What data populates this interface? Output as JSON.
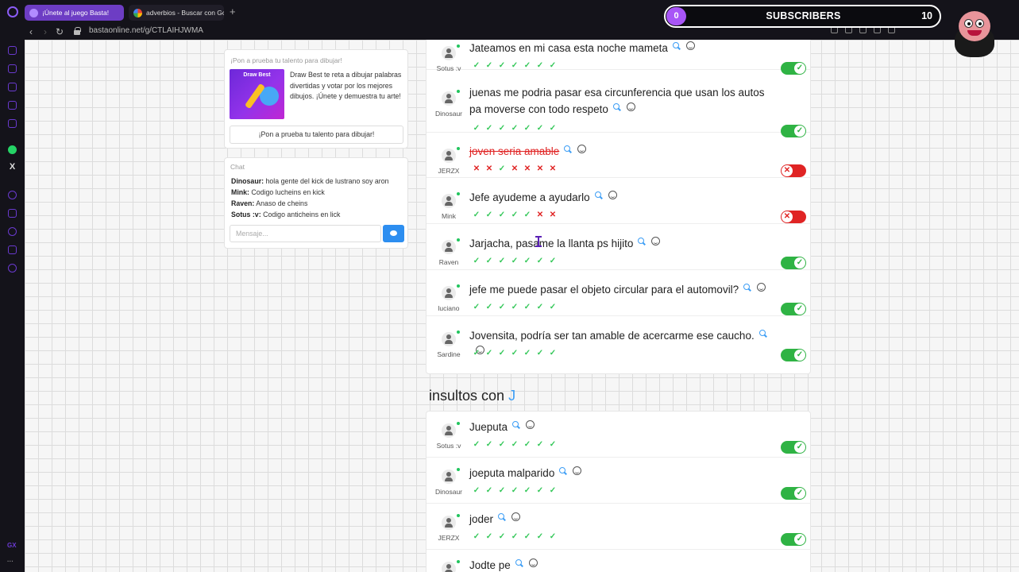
{
  "browser": {
    "tabs": [
      {
        "title": "¡Únete al juego Basta!",
        "active": true
      },
      {
        "title": "adverbios - Buscar con Go",
        "active": false
      }
    ],
    "new_tab": "+",
    "url": "bastaonline.net/g/CTLAIHJWMA"
  },
  "sidebar": {
    "bottom_label": "GX",
    "bottom_more": "···"
  },
  "promo": {
    "caption": "¡Pon a prueba tu talento para dibujar!",
    "image_title": "Draw Best",
    "text": "Draw Best te reta a dibujar palabras divertidas y votar por los mejores dibujos. ¡Únete y demuestra tu arte!",
    "button": "¡Pon a prueba tu talento para dibujar!"
  },
  "chat": {
    "title": "Chat",
    "messages": [
      {
        "user": "Dinosaur:",
        "text": " hola gente del kick de lustrano soy aron"
      },
      {
        "user": "Mink:",
        "text": " Codigo lucheins en kick"
      },
      {
        "user": "Raven:",
        "text": " Anaso de cheins"
      },
      {
        "user": "Sotus :v:",
        "text": " Codigo anticheins en lick"
      }
    ],
    "placeholder": "Mensaje..."
  },
  "answers_top": [
    {
      "user": "Sotus :v",
      "text": "Jateamos en mi casa esta noche mameta",
      "valid": true,
      "votes": [
        1,
        1,
        1,
        1,
        1,
        1,
        1
      ]
    },
    {
      "user": "Dinosaur",
      "text": "juenas me podria pasar esa circunferencia que usan los autos pa moverse con todo respeto",
      "valid": true,
      "votes": [
        1,
        1,
        1,
        1,
        1,
        1,
        1
      ]
    },
    {
      "user": "JERZX",
      "text": "joven seria amable",
      "valid": false,
      "votes": [
        0,
        0,
        1,
        0,
        0,
        0,
        0
      ]
    },
    {
      "user": "Mink",
      "text": "Jefe ayudeme a ayudarlo",
      "valid": false,
      "votes": [
        1,
        1,
        1,
        1,
        1,
        0,
        0
      ]
    },
    {
      "user": "Raven",
      "text": "Jarjacha, pasame la llanta ps hijito",
      "valid": true,
      "votes": [
        1,
        1,
        1,
        1,
        1,
        1,
        1
      ]
    },
    {
      "user": "luciano",
      "text": "jefe me puede pasar el objeto circular para el automovil?",
      "valid": true,
      "votes": [
        1,
        1,
        1,
        1,
        1,
        1,
        1
      ]
    },
    {
      "user": "Sardine",
      "text": "Jovensita, podría ser tan amable de acercarme ese caucho.",
      "valid": true,
      "votes": [
        1,
        1,
        1,
        1,
        1,
        1,
        1
      ]
    }
  ],
  "section": {
    "title": "insultos con ",
    "letter": "J"
  },
  "answers_bottom": [
    {
      "user": "Sotus :v",
      "text": "Jueputa",
      "valid": true,
      "votes": [
        1,
        1,
        1,
        1,
        1,
        1,
        1
      ]
    },
    {
      "user": "Dinosaur",
      "text": "joeputa malparido",
      "valid": true,
      "votes": [
        1,
        1,
        1,
        1,
        1,
        1,
        1
      ]
    },
    {
      "user": "JERZX",
      "text": "joder",
      "valid": true,
      "votes": [
        1,
        1,
        1,
        1,
        1,
        1,
        1
      ]
    },
    {
      "user": "",
      "text": "Jodte pe",
      "valid": true,
      "votes": []
    }
  ],
  "overlay": {
    "subs_current": "0",
    "subs_label": "SUBSCRIBERS",
    "subs_goal": "10"
  },
  "colors": {
    "accent": "#6d3dc4",
    "valid": "#2fb344",
    "invalid": "#e02424",
    "link": "#3b9df5"
  }
}
